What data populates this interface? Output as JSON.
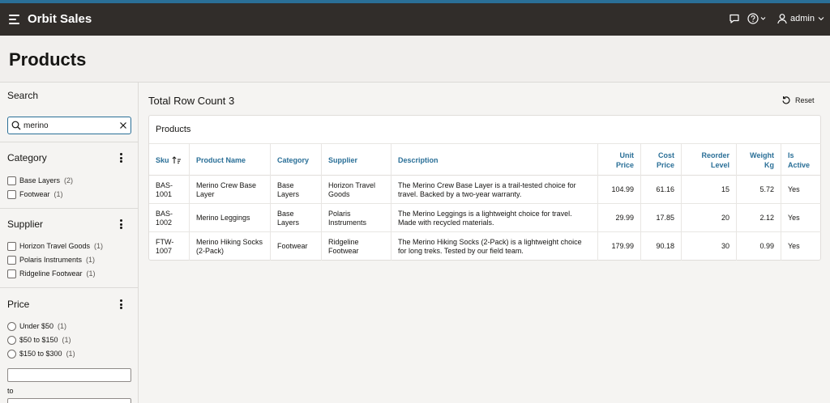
{
  "app": {
    "title": "Orbit Sales",
    "user": "admin"
  },
  "page": {
    "title": "Products"
  },
  "search": {
    "title": "Search",
    "value": "merino"
  },
  "facets": {
    "category": {
      "label": "Category",
      "items": [
        {
          "label": "Base Layers",
          "count": "(2)"
        },
        {
          "label": "Footwear",
          "count": "(1)"
        }
      ]
    },
    "supplier": {
      "label": "Supplier",
      "items": [
        {
          "label": "Horizon Travel Goods",
          "count": "(1)"
        },
        {
          "label": "Polaris Instruments",
          "count": "(1)"
        },
        {
          "label": "Ridgeline Footwear",
          "count": "(1)"
        }
      ]
    },
    "price": {
      "label": "Price",
      "items": [
        {
          "label": "Under $50",
          "count": "(1)"
        },
        {
          "label": "$50 to $150",
          "count": "(1)"
        },
        {
          "label": "$150 to $300",
          "count": "(1)"
        }
      ],
      "to_label": "to"
    }
  },
  "report": {
    "row_count": "Total Row Count 3",
    "reset_label": "Reset",
    "region_title": "Products",
    "columns": [
      "Sku",
      "Product Name",
      "Category",
      "Supplier",
      "Description",
      "Unit Price",
      "Cost Price",
      "Reorder Level",
      "Weight Kg",
      "Is Active"
    ],
    "rows": [
      {
        "sku": "BAS-1001",
        "name": "Merino Crew Base Layer",
        "category": "Base Layers",
        "supplier": "Horizon Travel Goods",
        "description": "The Merino Crew Base Layer is a trail-tested choice for travel. Backed by a two-year warranty.",
        "unit_price": "104.99",
        "cost_price": "61.16",
        "reorder_level": "15",
        "weight_kg": "5.72",
        "is_active": "Yes"
      },
      {
        "sku": "BAS-1002",
        "name": "Merino Leggings",
        "category": "Base Layers",
        "supplier": "Polaris Instruments",
        "description": "The Merino Leggings is a lightweight choice for travel. Made with recycled materials.",
        "unit_price": "29.99",
        "cost_price": "17.85",
        "reorder_level": "20",
        "weight_kg": "2.12",
        "is_active": "Yes"
      },
      {
        "sku": "FTW-1007",
        "name": "Merino Hiking Socks (2-Pack)",
        "category": "Footwear",
        "supplier": "Ridgeline Footwear",
        "description": "The Merino Hiking Socks (2-Pack) is a lightweight choice for long treks. Tested by our field team.",
        "unit_price": "179.99",
        "cost_price": "90.18",
        "reorder_level": "30",
        "weight_kg": "0.99",
        "is_active": "Yes"
      }
    ]
  },
  "icons": {
    "menu": "hamburger-icon",
    "chat": "chat-icon",
    "help": "help-icon",
    "user": "user-icon",
    "search": "search-icon",
    "clear": "close-icon",
    "sort": "sort-ascending-icon",
    "reset": "reset-icon",
    "more": "kebab-icon"
  },
  "colors": {
    "header_bg": "#312d2a",
    "accent_bar": "#2a6f97",
    "link": "#2a6f97"
  }
}
